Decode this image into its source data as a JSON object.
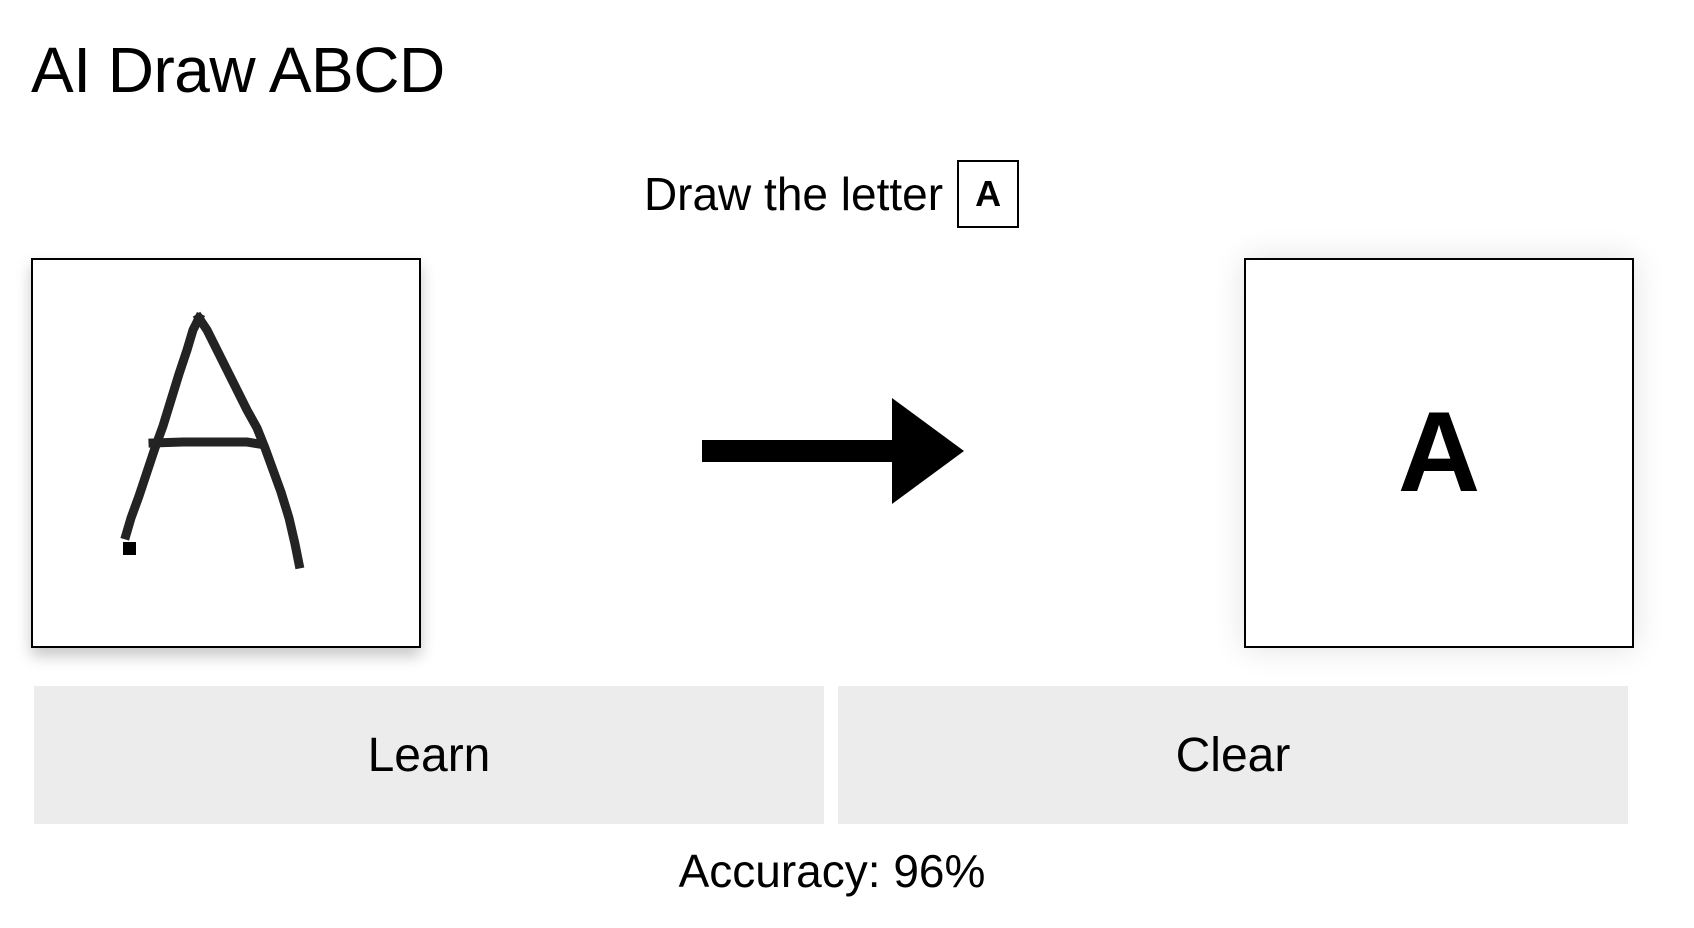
{
  "app": {
    "title": "AI Draw ABCD"
  },
  "prompt": {
    "label": "Draw the letter",
    "target_letter": "A"
  },
  "canvas": {
    "drawn_content": "handwritten letter A"
  },
  "arrow": {
    "icon": "right-arrow-icon"
  },
  "result": {
    "predicted_letter": "A"
  },
  "buttons": {
    "learn_label": "Learn",
    "clear_label": "Clear"
  },
  "status": {
    "accuracy": "Accuracy: 96%"
  },
  "colors": {
    "button_bg": "#ececec",
    "border": "#000000",
    "text": "#000000"
  }
}
